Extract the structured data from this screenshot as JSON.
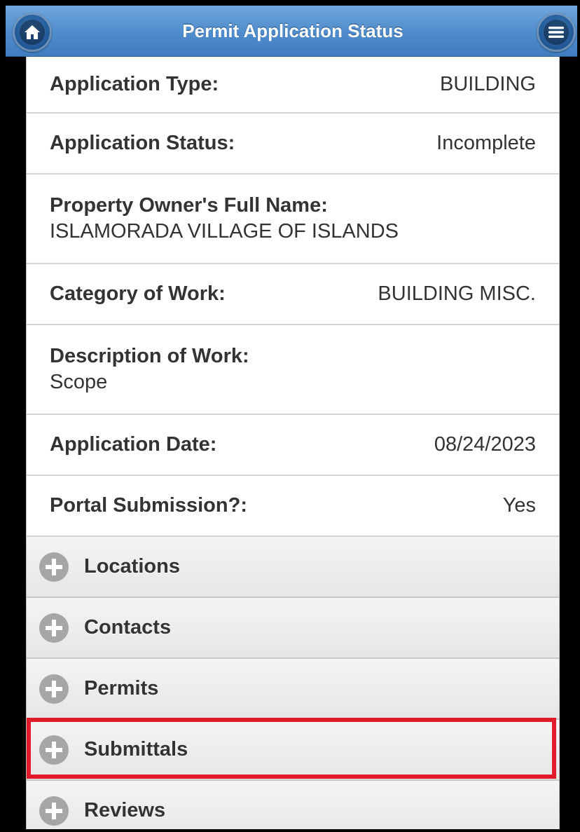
{
  "header": {
    "title": "Permit Application Status",
    "home_icon": "home-icon",
    "menu_icon": "menu-icon"
  },
  "details": [
    {
      "label": "Application Type:",
      "value": "BUILDING"
    },
    {
      "label": "Application Status:",
      "value": "Incomplete"
    },
    {
      "label": "Property Owner's Full Name:",
      "value": "ISLAMORADA VILLAGE OF ISLANDS"
    },
    {
      "label": "Category of Work:",
      "value": "BUILDING MISC."
    },
    {
      "label": "Description of Work:",
      "value": "Scope"
    },
    {
      "label": "Application Date:",
      "value": "08/24/2023"
    },
    {
      "label": "Portal Submission?:",
      "value": "Yes"
    }
  ],
  "sections": [
    {
      "label": "Locations"
    },
    {
      "label": "Contacts"
    },
    {
      "label": "Permits"
    },
    {
      "label": "Submittals",
      "highlighted": true
    },
    {
      "label": "Reviews"
    }
  ],
  "colors": {
    "header": "#4f8ccc",
    "highlight": "#e21b2b"
  }
}
